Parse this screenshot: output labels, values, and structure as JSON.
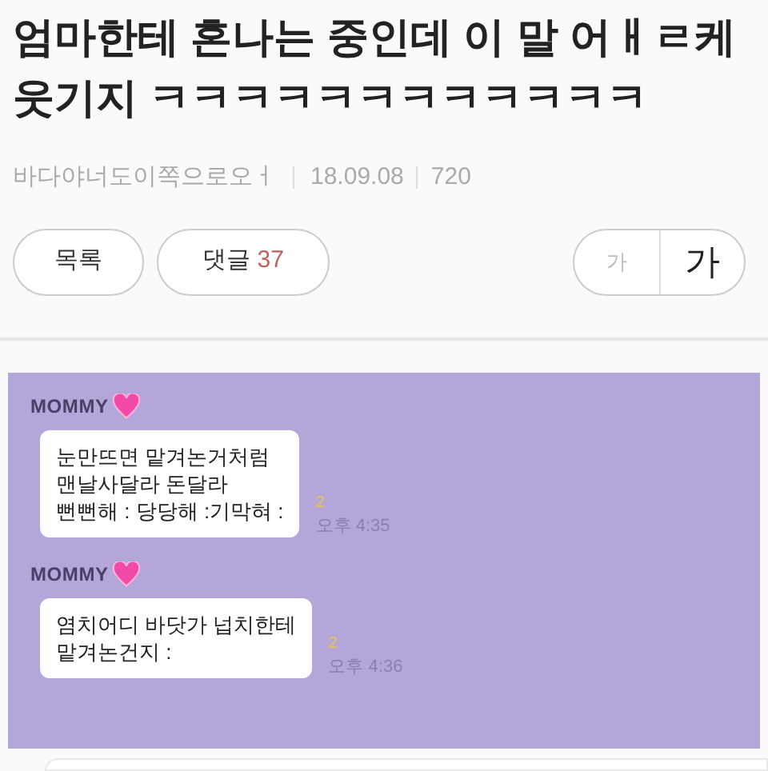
{
  "post": {
    "title": "엄마한테 혼나는 중인데 이 말 어ㅐㄹ케 웃기지 ㅋㅋㅋㅋㅋㅋㅋㅋㅋㅋㅋㅋ",
    "author": "바다야너도이쪽으로오ㅓ",
    "date": "18.09.08",
    "views": "720"
  },
  "actions": {
    "list_button": "목록",
    "comments_label": "댓글",
    "comments_count": "37",
    "font_small": "가",
    "font_large": "가"
  },
  "chat": [
    {
      "sender": "MOMMY",
      "lines": [
        "눈만뜨면 맡겨논거처럼",
        "맨날사달라 돈달라",
        "뻔뻔해 : 당당해 :기막혀 :"
      ],
      "unread": "2",
      "time": "오후 4:35"
    },
    {
      "sender": "MOMMY",
      "lines": [
        "염치어디 바닷가 넙치한테",
        "맡겨논건지 :"
      ],
      "unread": "2",
      "time": "오후 4:36"
    }
  ]
}
